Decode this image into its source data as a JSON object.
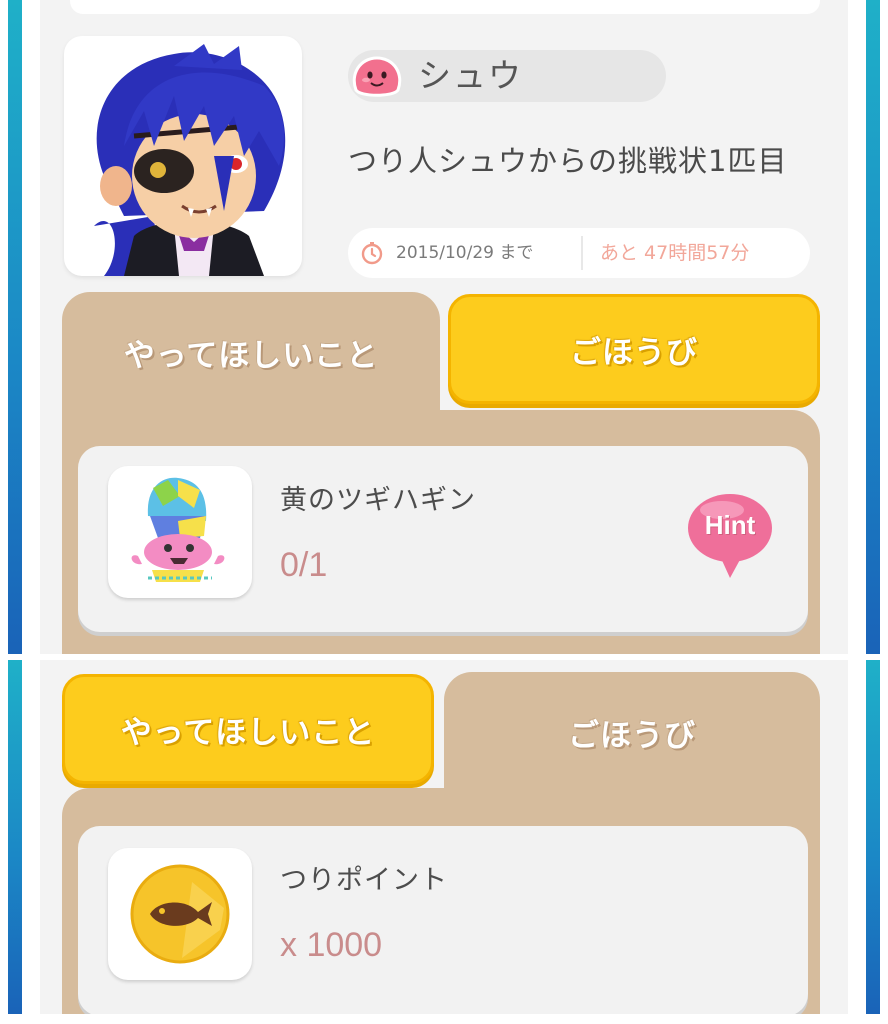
{
  "challenge": {
    "character_name": "シュウ",
    "title": "つり人シュウからの挑戦状1匹目",
    "deadline": "2015/10/29 まで",
    "remaining": "あと 47時間57分"
  },
  "tabs": {
    "tasks_label": "やってほしいこと",
    "reward_label": "ごほうび"
  },
  "task_item": {
    "name": "黄のツギハギン",
    "progress": "0/1",
    "hint_label": "Hint"
  },
  "reward_item": {
    "name": "つりポイント",
    "amount": "x 1000"
  },
  "colors": {
    "tab_active_yellow": "#fdcc1d",
    "tab_panel_beige": "#d6bc9d",
    "hint_pink": "#ef6f9a",
    "count_rose": "#c98c8c"
  },
  "icons": [
    "slime-icon",
    "clock-icon",
    "hint-bubble-icon",
    "fish-coin-icon"
  ]
}
